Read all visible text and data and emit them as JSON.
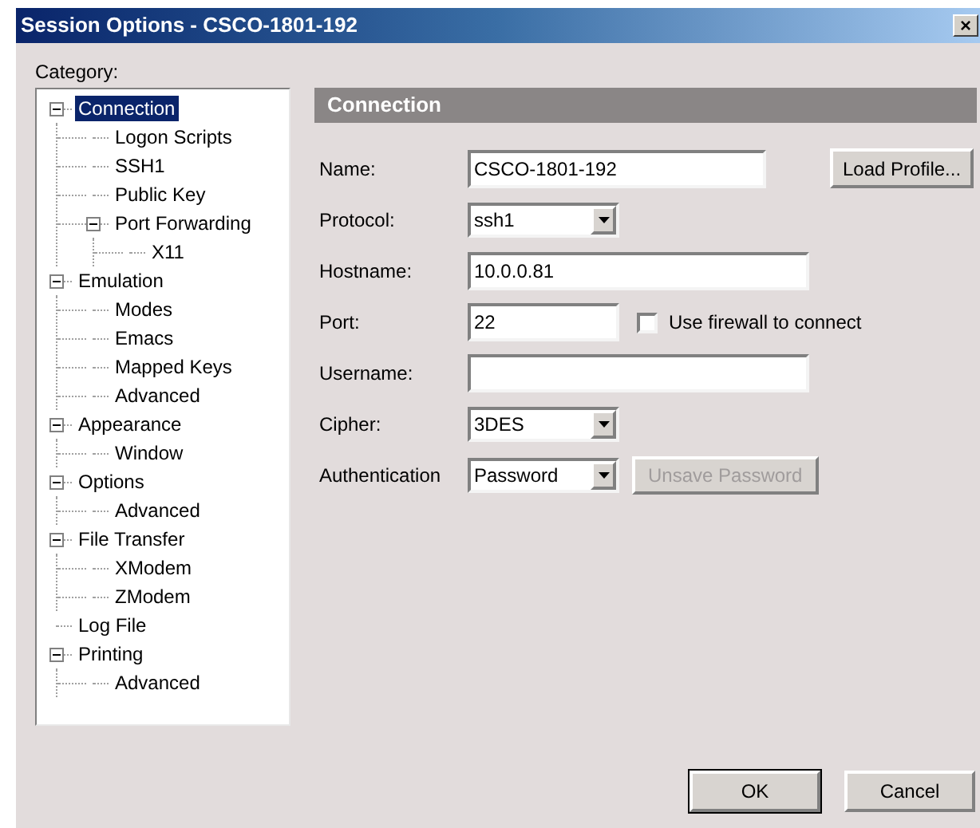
{
  "window": {
    "title": "Session Options - CSCO-1801-192",
    "close": "×"
  },
  "category_label": "Category:",
  "tree": [
    {
      "label": "Connection",
      "selected": true,
      "expanded": true,
      "children": [
        {
          "label": "Logon Scripts",
          "selected": false
        },
        {
          "label": "SSH1",
          "selected": false
        },
        {
          "label": "Public Key",
          "selected": false
        },
        {
          "label": "Port Forwarding",
          "selected": false,
          "expanded": true,
          "children": [
            {
              "label": "X11",
              "selected": false
            }
          ]
        }
      ]
    },
    {
      "label": "Emulation",
      "selected": false,
      "expanded": true,
      "children": [
        {
          "label": "Modes",
          "selected": false
        },
        {
          "label": "Emacs",
          "selected": false
        },
        {
          "label": "Mapped Keys",
          "selected": false
        },
        {
          "label": "Advanced",
          "selected": false
        }
      ]
    },
    {
      "label": "Appearance",
      "selected": false,
      "expanded": true,
      "children": [
        {
          "label": "Window",
          "selected": false
        }
      ]
    },
    {
      "label": "Options",
      "selected": false,
      "expanded": true,
      "children": [
        {
          "label": "Advanced",
          "selected": false
        }
      ]
    },
    {
      "label": "File Transfer",
      "selected": false,
      "expanded": true,
      "children": [
        {
          "label": "XModem",
          "selected": false
        },
        {
          "label": "ZModem",
          "selected": false
        }
      ]
    },
    {
      "label": "Log File",
      "selected": false
    },
    {
      "label": "Printing",
      "selected": false,
      "expanded": true,
      "children": [
        {
          "label": "Advanced",
          "selected": false
        }
      ]
    }
  ],
  "panel": {
    "title": "Connection",
    "name": {
      "label": "Name:",
      "value": "CSCO-1801-192"
    },
    "load_profile_button": "Load Profile...",
    "protocol": {
      "label": "Protocol:",
      "value": "ssh1"
    },
    "hostname": {
      "label": "Hostname:",
      "value": "10.0.0.81"
    },
    "port": {
      "label": "Port:",
      "value": "22"
    },
    "firewall": {
      "label": "Use firewall to connect",
      "checked": false
    },
    "username": {
      "label": "Username:"
    },
    "cipher": {
      "label": "Cipher:",
      "value": "3DES"
    },
    "authentication": {
      "label": "Authentication",
      "value": "Password"
    },
    "unsave_password_button": {
      "label": "Unsave Password",
      "disabled": true
    }
  },
  "buttons": [
    {
      "label": "OK",
      "default": true
    },
    {
      "label": "Cancel",
      "default": false
    }
  ]
}
